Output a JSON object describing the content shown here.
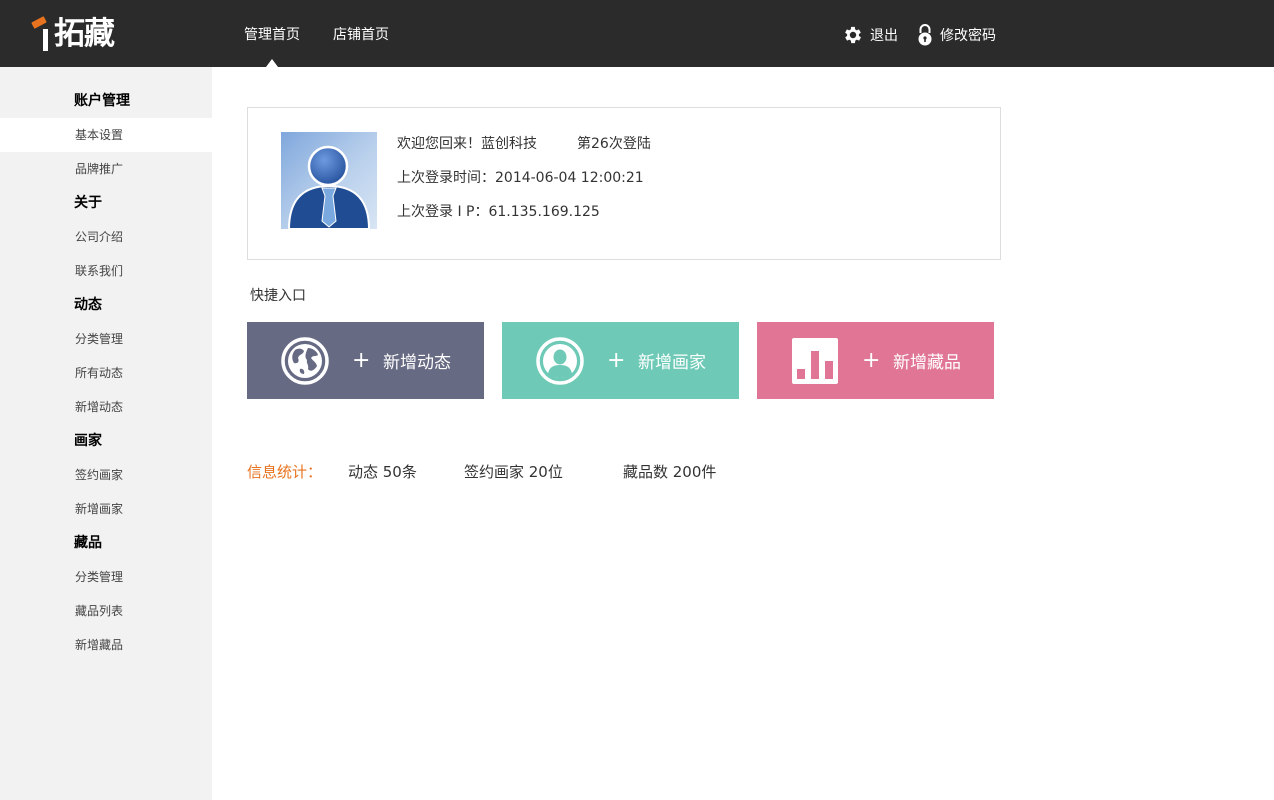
{
  "brand": {
    "name": "拓藏"
  },
  "nav": {
    "items": [
      "管理首页",
      "店铺首页"
    ]
  },
  "top_actions": {
    "logout": "退出",
    "change_password": "修改密码"
  },
  "sidebar": {
    "groups": [
      {
        "title": "账户管理",
        "items": [
          "基本设置",
          "品牌推广"
        ]
      },
      {
        "title": "关于",
        "items": [
          "公司介绍",
          "联系我们"
        ]
      },
      {
        "title": "动态",
        "items": [
          "分类管理",
          "所有动态",
          "新增动态"
        ]
      },
      {
        "title": "画家",
        "items": [
          "签约画家",
          "新增画家"
        ]
      },
      {
        "title": "藏品",
        "items": [
          "分类管理",
          "藏品列表",
          "新增藏品"
        ]
      }
    ]
  },
  "welcome": {
    "greeting": "欢迎您回来！蓝创科技",
    "login_count": "第26次登陆",
    "last_time": "上次登录时间：2014-06-04  12:00:21",
    "last_ip": "上次登录 I P：61.135.169.125"
  },
  "quick": {
    "title": "快捷入口",
    "tiles": [
      {
        "label": "新增动态",
        "icon": "globe-icon",
        "color": "#676a83"
      },
      {
        "label": "新增画家",
        "icon": "user-icon",
        "color": "#6ecab7"
      },
      {
        "label": "新增藏品",
        "icon": "bar-chart-icon",
        "color": "#e07595"
      }
    ],
    "plus": "+"
  },
  "stats": {
    "label": "信息统计：",
    "items": [
      "动态 50条",
      "签约画家 20位",
      "藏品数 200件"
    ]
  },
  "colors": {
    "topbar": "#2b2b2b",
    "sidebar": "#f2f2f2",
    "accent": "#e8731f"
  }
}
